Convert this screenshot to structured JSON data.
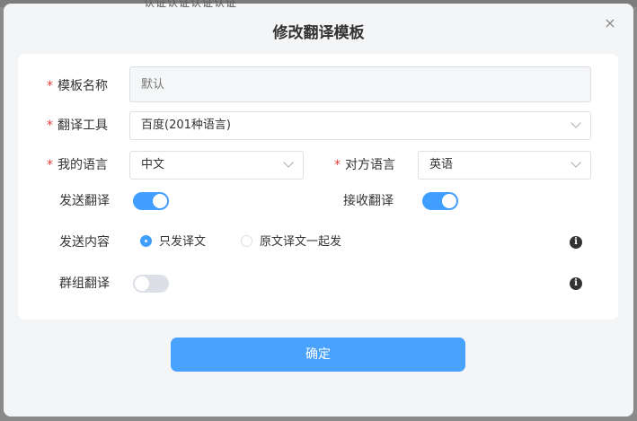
{
  "backdrop": {
    "text": "认证认证认证认证"
  },
  "modal": {
    "title": "修改翻译模板",
    "close_glyph": "×"
  },
  "form": {
    "required_mark": "*",
    "template_name": {
      "label": "模板名称",
      "placeholder": "默认"
    },
    "translate_tool": {
      "label": "翻译工具",
      "value": "百度(201种语言)"
    },
    "my_language": {
      "label": "我的语言",
      "value": "中文"
    },
    "other_language": {
      "label": "对方语言",
      "value": "英语"
    },
    "send_translate": {
      "label": "发送翻译",
      "enabled": true
    },
    "receive_translate": {
      "label": "接收翻译",
      "enabled": true
    },
    "send_content": {
      "label": "发送内容",
      "options": [
        "只发译文",
        "原文译文一起发"
      ],
      "selected": "只发译文"
    },
    "group_translate": {
      "label": "群组翻译",
      "enabled": false
    },
    "info_glyph": "i"
  },
  "confirm_button": {
    "label": "确定"
  },
  "colors": {
    "accent": "#409eff",
    "button": "#4aa2ff",
    "required": "#e4393c"
  }
}
